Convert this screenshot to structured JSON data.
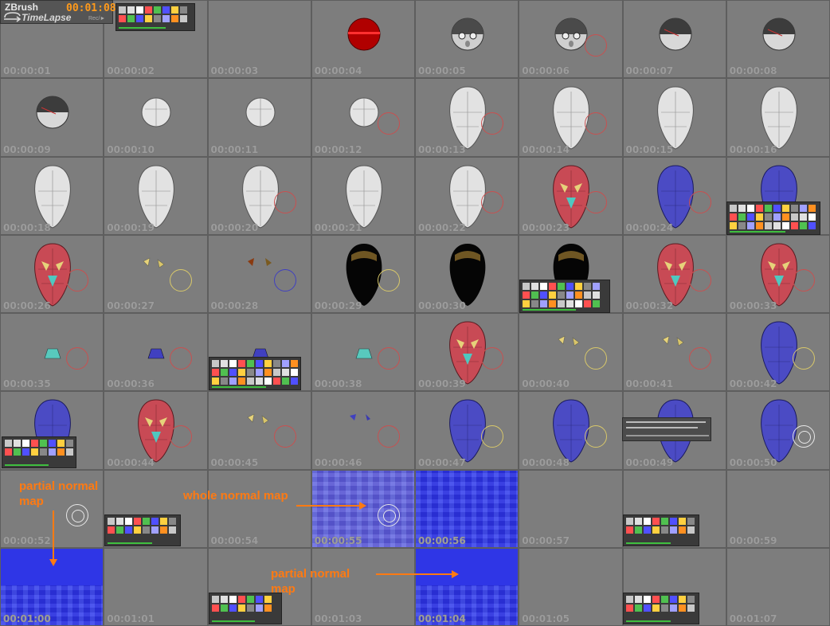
{
  "app": {
    "brand": "ZBrush",
    "subtitle": "TimeLapse",
    "clock": "00:01:08",
    "record_label": "Rec/►"
  },
  "frames": [
    {
      "ts": "00:00:01",
      "model": "none",
      "icon": "none"
    },
    {
      "ts": "00:00:02",
      "model": "none",
      "icon": "none"
    },
    {
      "ts": "00:00:03",
      "model": "none",
      "icon": "none"
    },
    {
      "ts": "00:00:04",
      "model": "red-sphere",
      "icon": "none"
    },
    {
      "ts": "00:00:05",
      "model": "face-sphere",
      "icon": "none"
    },
    {
      "ts": "00:00:06",
      "model": "face-sphere",
      "icon": "red-ring"
    },
    {
      "ts": "00:00:07",
      "model": "dark-sphere",
      "icon": "none"
    },
    {
      "ts": "00:00:08",
      "model": "dark-sphere",
      "icon": "none"
    },
    {
      "ts": "00:00:09",
      "model": "dark-sphere",
      "icon": "none"
    },
    {
      "ts": "00:00:10",
      "model": "white-sphere",
      "icon": "none"
    },
    {
      "ts": "00:00:11",
      "model": "white-sphere",
      "icon": "none"
    },
    {
      "ts": "00:00:12",
      "model": "white-sphere",
      "icon": "red-ring"
    },
    {
      "ts": "00:00:13",
      "model": "white-head",
      "icon": "red-ring"
    },
    {
      "ts": "00:00:14",
      "model": "white-head",
      "icon": "red-ring"
    },
    {
      "ts": "00:00:15",
      "model": "white-head",
      "icon": "none"
    },
    {
      "ts": "00:00:16",
      "model": "white-head",
      "icon": "none"
    },
    {
      "ts": "00:00:18",
      "model": "white-head",
      "icon": "none"
    },
    {
      "ts": "00:00:19",
      "model": "white-head",
      "icon": "none"
    },
    {
      "ts": "00:00:20",
      "model": "white-head",
      "icon": "red-ring"
    },
    {
      "ts": "00:00:21",
      "model": "white-head",
      "icon": "none"
    },
    {
      "ts": "00:00:22",
      "model": "white-head",
      "icon": "red-ring"
    },
    {
      "ts": "00:00:23",
      "model": "red-head",
      "icon": "red-ring"
    },
    {
      "ts": "00:00:24",
      "model": "blue-head",
      "icon": "red-ring"
    },
    {
      "ts": "00:00:25",
      "model": "blue-head",
      "icon": "none"
    },
    {
      "ts": "00:00:26",
      "model": "red-head",
      "icon": "red-ring"
    },
    {
      "ts": "00:00:27",
      "model": "eye-parts",
      "icon": "yellow-ring"
    },
    {
      "ts": "00:00:28",
      "model": "eye-parts-dark",
      "icon": "blue-ring"
    },
    {
      "ts": "00:00:29",
      "model": "black-head",
      "icon": "yellow-ring"
    },
    {
      "ts": "00:00:30",
      "model": "black-head",
      "icon": "none"
    },
    {
      "ts": "00:00:31",
      "model": "black-head",
      "icon": "none"
    },
    {
      "ts": "00:00:32",
      "model": "red-head",
      "icon": "red-ring"
    },
    {
      "ts": "00:00:33",
      "model": "red-head",
      "icon": "red-ring"
    },
    {
      "ts": "00:00:35",
      "model": "nose-part",
      "icon": "red-ring"
    },
    {
      "ts": "00:00:36",
      "model": "nose-blue",
      "icon": "red-ring"
    },
    {
      "ts": "00:00:37",
      "model": "nose-blue",
      "icon": "none"
    },
    {
      "ts": "00:00:38",
      "model": "nose-part",
      "icon": "red-ring"
    },
    {
      "ts": "00:00:39",
      "model": "red-head",
      "icon": "red-ring"
    },
    {
      "ts": "00:00:40",
      "model": "eye-parts",
      "icon": "yellow-ring"
    },
    {
      "ts": "00:00:41",
      "model": "eye-parts",
      "icon": "red-ring"
    },
    {
      "ts": "00:00:42",
      "model": "blue-head",
      "icon": "yellow-ring"
    },
    {
      "ts": "00:00:43",
      "model": "blue-head",
      "icon": "none"
    },
    {
      "ts": "00:00:44",
      "model": "red-head",
      "icon": "red-ring"
    },
    {
      "ts": "00:00:45",
      "model": "eye-parts",
      "icon": "red-ring"
    },
    {
      "ts": "00:00:46",
      "model": "eye-parts-blue",
      "icon": "red-ring"
    },
    {
      "ts": "00:00:47",
      "model": "blue-head",
      "icon": "yellow-ring"
    },
    {
      "ts": "00:00:48",
      "model": "blue-head",
      "icon": "yellow-ring"
    },
    {
      "ts": "00:00:49",
      "model": "blue-head",
      "icon": "none"
    },
    {
      "ts": "00:00:50",
      "model": "blue-head",
      "icon": "white-ring"
    },
    {
      "ts": "00:00:52",
      "model": "none",
      "icon": "white-ring"
    },
    {
      "ts": "00:00:53",
      "model": "none",
      "icon": "none"
    },
    {
      "ts": "00:00:54",
      "model": "none",
      "icon": "none"
    },
    {
      "ts": "00:00:55",
      "model": "normal-map-purple",
      "icon": "white-ring"
    },
    {
      "ts": "00:00:56",
      "model": "normal-map-blue",
      "icon": "none"
    },
    {
      "ts": "00:00:57",
      "model": "none",
      "icon": "none"
    },
    {
      "ts": "00:00:58",
      "model": "none",
      "icon": "none"
    },
    {
      "ts": "00:00:59",
      "model": "none",
      "icon": "none"
    },
    {
      "ts": "00:01:00",
      "model": "normal-map-partial",
      "icon": "none"
    },
    {
      "ts": "00:01:01",
      "model": "none",
      "icon": "none"
    },
    {
      "ts": "00:01:02",
      "model": "none",
      "icon": "none"
    },
    {
      "ts": "00:01:03",
      "model": "none",
      "icon": "none"
    },
    {
      "ts": "00:01:04",
      "model": "normal-map-partial",
      "icon": "none"
    },
    {
      "ts": "00:01:05",
      "model": "none",
      "icon": "none"
    },
    {
      "ts": "00:01:06",
      "model": "none",
      "icon": "none"
    },
    {
      "ts": "00:01:07",
      "model": "none",
      "icon": "none"
    }
  ],
  "annotations": {
    "partial_1": "partial normal map",
    "whole": "whole normal map",
    "partial_2": "partial normal map"
  },
  "colors": {
    "accent": "#ff7a12",
    "cell_bg": "#7d7d7d",
    "normal_map_blue": "#2f36e6",
    "timestamp": "#9c9c9c"
  }
}
